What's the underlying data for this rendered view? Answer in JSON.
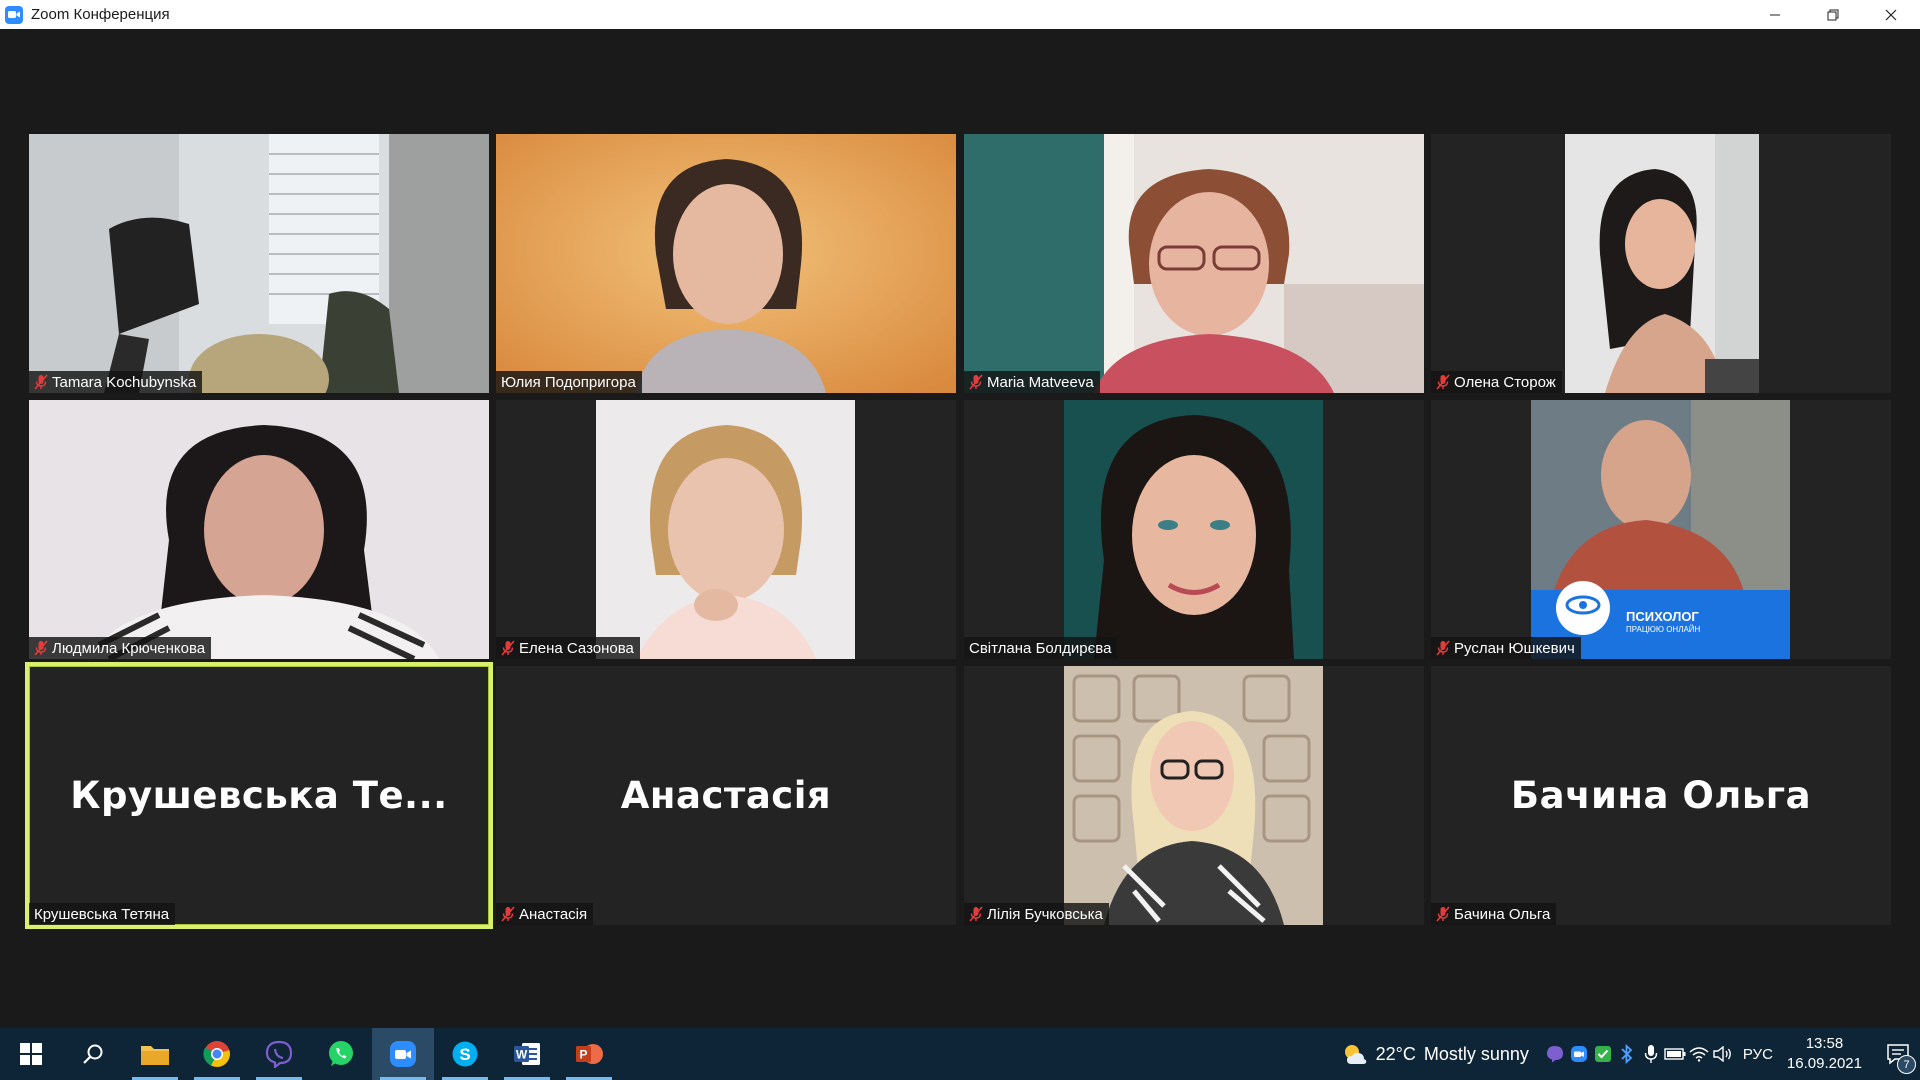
{
  "window": {
    "title": "Zoom Конференция"
  },
  "participants": [
    {
      "name": "Tamara Kochubynska",
      "muted": true,
      "video": "full",
      "scene": "office"
    },
    {
      "name": "Юлия Подопригора",
      "muted": false,
      "video": "full",
      "scene": "orange-wall"
    },
    {
      "name": "Maria Matveeva",
      "muted": true,
      "video": "full",
      "scene": "curtain-room"
    },
    {
      "name": "Олена Сторож",
      "muted": true,
      "video": "narrow",
      "scene": "grey-wall"
    },
    {
      "name": "Людмила Крюченкова",
      "muted": true,
      "video": "full",
      "scene": "light-room"
    },
    {
      "name": "Елена Сазонова",
      "muted": true,
      "video": "narrow",
      "scene": "portrait-light"
    },
    {
      "name": "Світлана Болдирєва",
      "muted": false,
      "video": "narrow",
      "scene": "teal-portrait"
    },
    {
      "name": "Руслан Юшкевич",
      "muted": true,
      "video": "narrow",
      "scene": "psychologist-banner",
      "banner_title": "ПСИХОЛОГ",
      "banner_subtitle": "ПРАЦЮЮ ОНЛАЙН"
    },
    {
      "name": "Крушевська Тетяна",
      "muted": false,
      "video": "off",
      "display_name": "Крушевська  Те...",
      "active_speaker": true
    },
    {
      "name": "Анастасія",
      "muted": true,
      "video": "off",
      "display_name": "Анастасія"
    },
    {
      "name": "Лілія Бучковська",
      "muted": true,
      "video": "narrow",
      "scene": "tiled-wall"
    },
    {
      "name": "Бачина Ольга",
      "muted": true,
      "video": "off",
      "display_name": "Бачина Ольга"
    }
  ],
  "taskbar": {
    "apps": [
      {
        "icon": "windows-start-icon"
      },
      {
        "icon": "search-icon"
      },
      {
        "icon": "file-explorer-icon"
      },
      {
        "icon": "chrome-icon"
      },
      {
        "icon": "viber-icon"
      },
      {
        "icon": "whatsapp-icon"
      },
      {
        "icon": "zoom-icon",
        "active": true
      },
      {
        "icon": "skype-icon"
      },
      {
        "icon": "word-icon"
      },
      {
        "icon": "powerpoint-icon"
      }
    ],
    "weather": {
      "temperature": "22°C",
      "condition": "Mostly sunny"
    },
    "language": "РУС",
    "time": "13:58",
    "date": "16.09.2021",
    "notification_count": "7"
  },
  "colors": {
    "active_speaker_border": "#d9ef6d",
    "muted_icon": "#e23c3c",
    "taskbar_bg": "#0e2437",
    "zoom_blue": "#2d8cff"
  }
}
